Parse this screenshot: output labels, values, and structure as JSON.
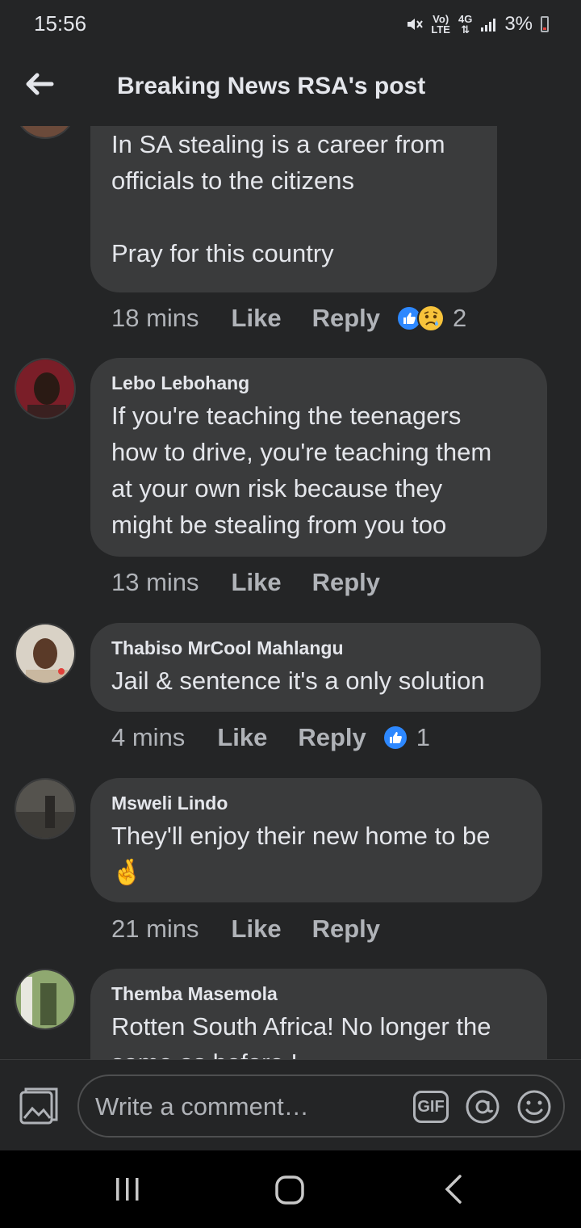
{
  "status_bar": {
    "time": "15:56",
    "network_label_top": "Vo)",
    "network_label_bottom": "LTE",
    "data_label": "4G",
    "battery_percent": "3%",
    "battery_color": "#e0403a"
  },
  "header": {
    "back_icon": "back-arrow-icon",
    "title": "Breaking News RSA's post"
  },
  "comments": [
    {
      "name": "",
      "text": "In SA stealing is a career from\nofficials to the citizens\n\nPray for this country",
      "time": "18 mins",
      "like_label": "Like",
      "reply_label": "Reply",
      "reactions": [
        "like",
        "sad"
      ],
      "reaction_count": "2"
    },
    {
      "name": "Lebo Lebohang",
      "text": "If you're teaching the teenagers\nhow to drive, you're teaching them\nat your own risk because they\nmight be stealing from you too",
      "time": "13 mins",
      "like_label": "Like",
      "reply_label": "Reply"
    },
    {
      "name": "Thabiso MrCool Mahlangu",
      "text": "Jail & sentence it's a only solution",
      "time": "4 mins",
      "like_label": "Like",
      "reply_label": "Reply",
      "reactions": [
        "like"
      ],
      "reaction_count": "1"
    },
    {
      "name": "Msweli Lindo",
      "text": "They'll enjoy their new home to be\n🤞",
      "time": "21 mins",
      "like_label": "Like",
      "reply_label": "Reply"
    },
    {
      "name": "Themba Masemola",
      "text": "Rotten South Africa! No longer the\nsame as before !"
    }
  ],
  "composer": {
    "placeholder": "Write a comment…",
    "gif_label": "GIF",
    "photo_icon": "photo-icon",
    "at_icon": "mention-icon",
    "emoji_icon": "emoji-icon"
  },
  "colors": {
    "background": "#242526",
    "bubble": "#3a3b3c",
    "text": "#e4e6eb",
    "secondary_text": "#b0b3b8",
    "like_blue": "#2d88ff",
    "sad_yellow": "#f7c33b"
  }
}
